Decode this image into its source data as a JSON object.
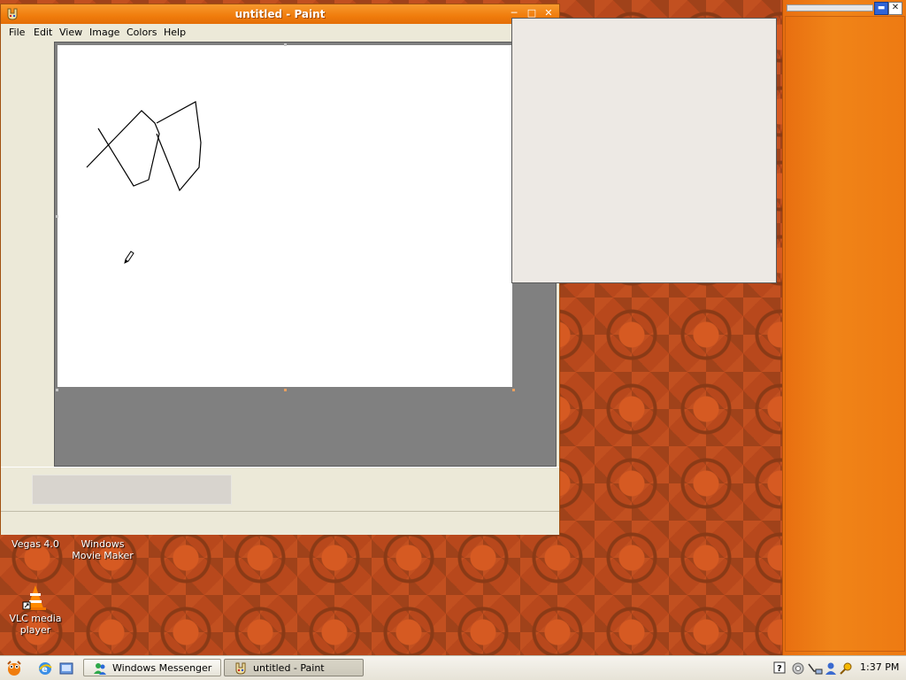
{
  "paint": {
    "title": "untitled - Paint",
    "menu": [
      "File",
      "Edit",
      "View",
      "Image",
      "Colors",
      "Help"
    ]
  },
  "desktop": {
    "icons": [
      {
        "label": "Vegas 4.0"
      },
      {
        "label": "Windows Movie Maker"
      },
      {
        "label": "VLC media player"
      }
    ]
  },
  "taskbar": {
    "buttons": [
      {
        "label": "Windows Messenger"
      },
      {
        "label": "untitled - Paint"
      }
    ],
    "clock": "1:37 PM"
  },
  "colors": {
    "accent": "#f07c0c",
    "canvas": "#ffffff",
    "workspace": "#808080"
  }
}
